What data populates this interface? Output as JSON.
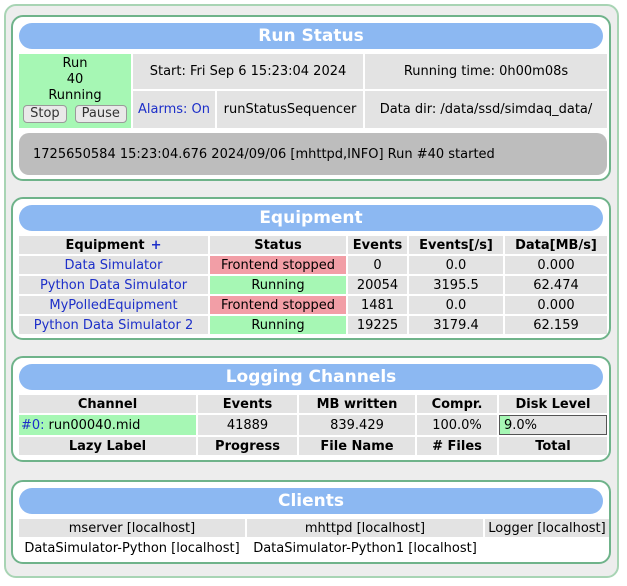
{
  "run_status": {
    "title": "Run Status",
    "run_label": "Run",
    "run_number": "40",
    "state": "Running",
    "stop_label": "Stop",
    "pause_label": "Pause",
    "start_time": "Start: Fri Sep 6 15:23:04 2024",
    "running_time": "Running time: 0h00m08s",
    "alarms": "Alarms: On",
    "sequencer": "runStatusSequencer",
    "data_dir": "Data dir: /data/ssd/simdaq_data/",
    "message": "1725650584 15:23:04.676 2024/09/06 [mhttpd,INFO] Run #40 started"
  },
  "equipment": {
    "title": "Equipment",
    "headers": {
      "equipment": "Equipment",
      "add": "+",
      "status": "Status",
      "events": "Events",
      "rate": "Events[/s]",
      "data": "Data[MB/s]"
    },
    "rows": [
      {
        "name": "Data Simulator",
        "status": "Frontend stopped",
        "events": "0",
        "rate": "0.0",
        "data": "0.000"
      },
      {
        "name": "Python Data Simulator",
        "status": "Running",
        "events": "20054",
        "rate": "3195.5",
        "data": "62.474"
      },
      {
        "name": "MyPolledEquipment",
        "status": "Frontend stopped",
        "events": "1481",
        "rate": "0.0",
        "data": "0.000"
      },
      {
        "name": "Python Data Simulator 2",
        "status": "Running",
        "events": "19225",
        "rate": "3179.4",
        "data": "62.159"
      }
    ]
  },
  "logging": {
    "title": "Logging Channels",
    "headers": {
      "channel": "Channel",
      "events": "Events",
      "mb": "MB written",
      "compr": "Compr.",
      "disk": "Disk Level"
    },
    "channel": {
      "id": "#0:",
      "file": "run00040.mid",
      "events": "41889",
      "mb": "839.429",
      "compr": "100.0%",
      "disk": "9.0%",
      "disk_fraction": 0.09
    },
    "lazy_headers": {
      "label": "Lazy Label",
      "progress": "Progress",
      "file": "File Name",
      "files": "# Files",
      "total": "Total"
    }
  },
  "clients": {
    "title": "Clients",
    "items": [
      "mserver [localhost]",
      "mhttpd [localhost]",
      "Logger [localhost]",
      "DataSimulator-Python [localhost]",
      "DataSimulator-Python1 [localhost]"
    ]
  },
  "colors": {
    "header_blue": "#8cb8f2",
    "running_green": "#a6f7b4",
    "stopped_red": "#f29ea6",
    "panel_border": "#6fb38a"
  }
}
